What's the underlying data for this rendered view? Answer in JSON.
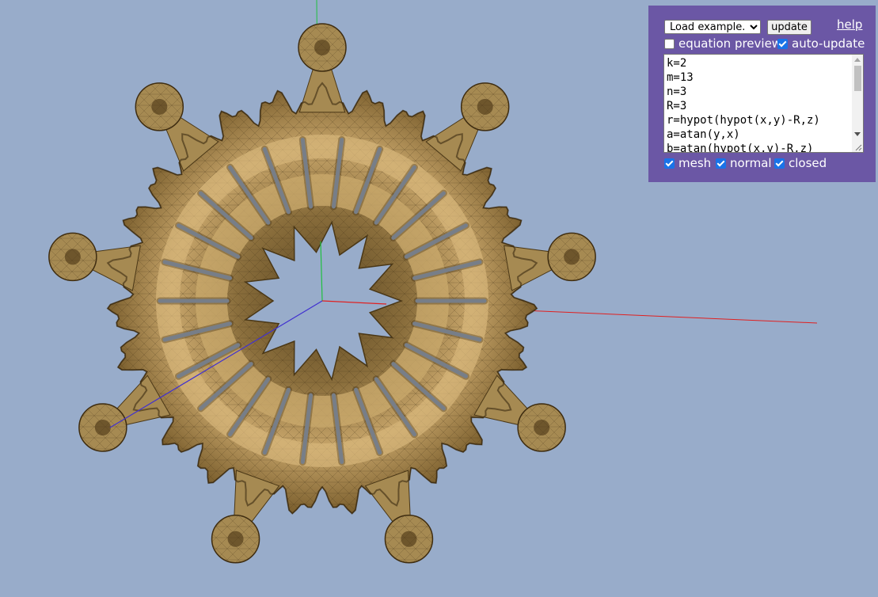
{
  "panel": {
    "example_select": {
      "selected": "Load example..."
    },
    "update_label": "update",
    "help_label": "help",
    "equation_preview": {
      "label": "equation preview",
      "checked": false
    },
    "auto_update": {
      "label": "auto-update",
      "checked": true
    },
    "equation_lines": [
      "k=2",
      "m=13",
      "n=3",
      "R=3",
      "r=hypot(hypot(x,y)-R,z)",
      "a=atan(y,x)",
      "b=atan(hypot(x,y)-R,z)"
    ],
    "mesh": {
      "label": "mesh",
      "checked": true
    },
    "normal": {
      "label": "normal",
      "checked": true
    },
    "closed": {
      "label": "closed",
      "checked": true
    }
  },
  "scene": {
    "background": "#98acca",
    "surface_color": "#a68a52",
    "axis_colors": {
      "x": "#e02020",
      "y": "#20c040",
      "z": "#4030d0"
    },
    "shape": "torus-fractal",
    "spikes": 9
  },
  "colors": {
    "panel": "#6b57a5",
    "checkbox_on": "#1a73e8"
  }
}
